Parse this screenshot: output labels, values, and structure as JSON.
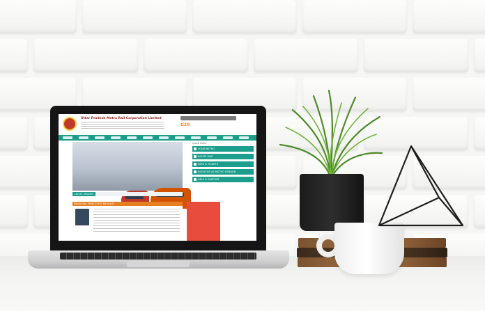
{
  "scene": {
    "colors": {
      "wall": "#f6f6f4",
      "accent_teal": "#1b9e8c",
      "accent_orange": "#e67e22",
      "brand_red": "#8b1a1a"
    }
  },
  "site": {
    "org_name": "Uttar Pradesh Metro Rail Corporation Limited",
    "g20_badge": "G20",
    "nav_count": 12,
    "quick_links_title": "Quick Links",
    "quick_links": [
      "YOUR METRO",
      "ROUTE MAP",
      "FARE & TICKETS",
      "REGISTER AS METRO VENDOR",
      "HELP & SUPPORT"
    ],
    "ticker_label": "LATEST UPDATES",
    "md_section_title": "MANAGING DIRECTOR'S MESSAGE"
  }
}
